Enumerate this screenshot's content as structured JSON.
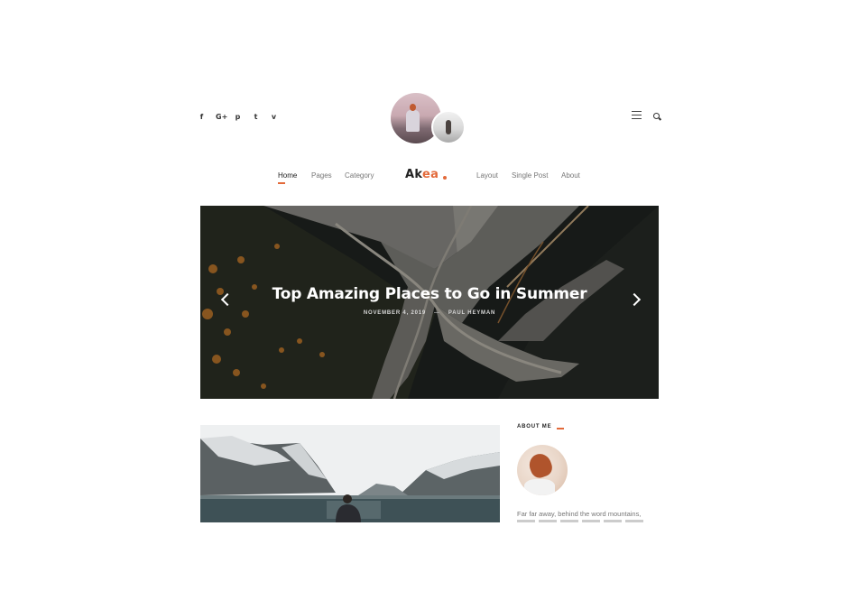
{
  "social": {
    "icons": [
      "facebook-icon",
      "google-plus-icon",
      "pinterest-icon",
      "twitter-icon",
      "vimeo-icon"
    ],
    "glyphs": [
      "f",
      "G+",
      "p",
      "t",
      "v"
    ]
  },
  "nav": {
    "items_left": [
      "Home",
      "Pages",
      "Category"
    ],
    "items_right": [
      "Layout",
      "Single Post",
      "About"
    ],
    "active": "Home"
  },
  "brand": {
    "name_main": "Ak",
    "name_accent": "ea",
    "accent_color": "#e36a3a"
  },
  "hero": {
    "title": "Top Amazing Places to Go in Summer",
    "date": "NOVEMBER 4, 2019",
    "separator": "—",
    "author": "PAUL HEYMAN"
  },
  "sidebar": {
    "about_title": "ABOUT ME",
    "about_text": "Far far away, behind the word mountains,"
  },
  "colors": {
    "accent": "#e36a3a",
    "text": "#222222",
    "muted": "#777777"
  }
}
